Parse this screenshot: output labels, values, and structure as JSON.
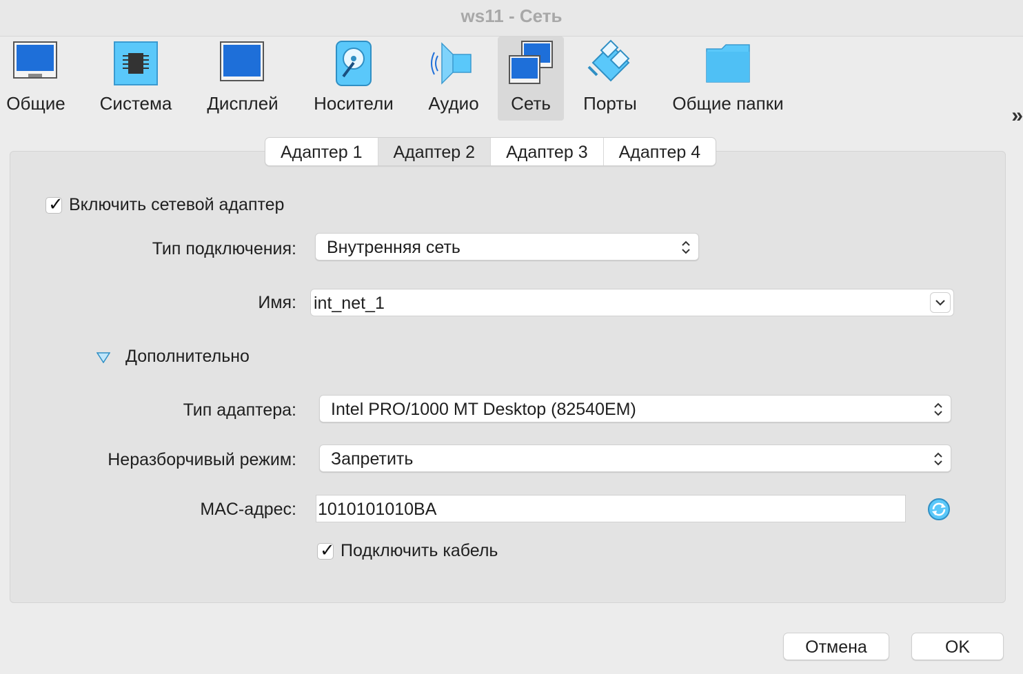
{
  "window": {
    "title": "ws11 - Сеть"
  },
  "toolbar": {
    "items": [
      {
        "label": "Общие",
        "icon": "general-monitor-icon"
      },
      {
        "label": "Система",
        "icon": "system-chip-icon"
      },
      {
        "label": "Дисплей",
        "icon": "display-monitor-icon"
      },
      {
        "label": "Носители",
        "icon": "storage-disk-icon"
      },
      {
        "label": "Аудио",
        "icon": "audio-speaker-icon"
      },
      {
        "label": "Сеть",
        "icon": "network-icon",
        "selected": true
      },
      {
        "label": "Порты",
        "icon": "ports-icon"
      },
      {
        "label": "Общие папки",
        "icon": "shared-folder-icon"
      }
    ],
    "more": "»"
  },
  "tabs": [
    {
      "label": "Адаптер 1"
    },
    {
      "label": "Адаптер 2",
      "active": true
    },
    {
      "label": "Адаптер 3"
    },
    {
      "label": "Адаптер 4"
    }
  ],
  "adapter": {
    "enable_label": "Включить сетевой адаптер",
    "enabled": true,
    "attach_label": "Тип подключения:",
    "attach_value": "Внутренняя сеть",
    "name_label": "Имя:",
    "name_value": "int_net_1",
    "advanced_label": "Дополнительно",
    "type_label": "Тип адаптера:",
    "type_value": "Intel PRO/1000 MT Desktop (82540EM)",
    "promisc_label": "Неразборчивый режим:",
    "promisc_value": "Запретить",
    "mac_label": "MAC-адрес:",
    "mac_value": "1010101010BA",
    "cable_label": "Подключить кабель",
    "cable_connected": true
  },
  "buttons": {
    "cancel": "Отмена",
    "ok": "OK"
  },
  "colors": {
    "accent_blue": "#1e6fd9",
    "icon_cyan": "#5ac8fa",
    "selected_tool_bg": "#d9d9d9"
  }
}
